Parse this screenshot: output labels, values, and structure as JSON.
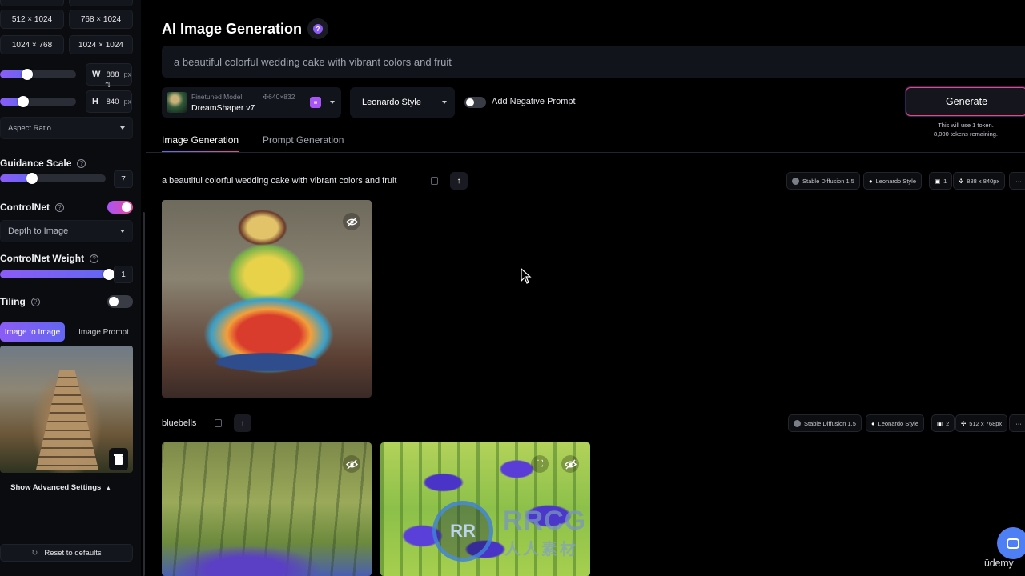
{
  "sidebar": {
    "dimensions": [
      {
        "label": "512 × 1024"
      },
      {
        "label": "768 × 1024"
      },
      {
        "label": "1024 × 768"
      },
      {
        "label": "1024 × 1024"
      }
    ],
    "width": {
      "label": "W",
      "value": "888",
      "unit": "px"
    },
    "height": {
      "label": "H",
      "value": "840",
      "unit": "px"
    },
    "swap_icon": "swap-vertical-arrows",
    "aspect_ratio": {
      "label": "Aspect Ratio"
    },
    "guidance_scale": {
      "label": "Guidance Scale",
      "value": "7",
      "fraction": 0.3
    },
    "controlnet": {
      "label": "ControlNet",
      "enabled": true,
      "mode": "Depth to Image"
    },
    "controlnet_weight": {
      "label": "ControlNet Weight",
      "value": "1",
      "fraction": 1.0
    },
    "tiling": {
      "label": "Tiling",
      "enabled": false
    },
    "image_tabs": [
      {
        "label": "Image to Image",
        "active": true
      },
      {
        "label": "Image Prompt",
        "active": false
      }
    ],
    "show_advanced": "Show Advanced Settings",
    "reset": "Reset to defaults"
  },
  "header": {
    "title": "AI Image Generation",
    "help_badge": "?",
    "prompt": "a beautiful colorful wedding cake with vibrant colors and fruit",
    "model": {
      "caption": "Finetuned Model",
      "resolution": "640×832",
      "name": "DreamShaper v7"
    },
    "style": "Leonardo Style",
    "negative_prompt_label": "Add Negative Prompt",
    "generate_label": "Generate",
    "token_line1": "This will use 1 token.",
    "token_line2": "8,000 tokens remaining."
  },
  "tabs": [
    {
      "label": "Image Generation",
      "active": true
    },
    {
      "label": "Prompt Generation",
      "active": false
    }
  ],
  "generations": [
    {
      "prompt": "a beautiful colorful wedding cake with vibrant colors and fruit",
      "model": "Stable Diffusion 1.5",
      "style": "Leonardo Style",
      "count": "1",
      "size": "888 x 840px",
      "more": "···"
    },
    {
      "prompt": "bluebells",
      "model": "Stable Diffusion 1.5",
      "style": "Leonardo Style",
      "count": "2",
      "size": "512 x 768px",
      "more": "···"
    }
  ],
  "watermark": {
    "brand": "RRCG",
    "sub": "人人素材",
    "mark": "RR"
  },
  "footer": {
    "udemy": "ūdemy"
  },
  "colors": {
    "accent_purple": "#8b5cf6",
    "accent_indigo": "#6366f1",
    "generate_border": "#e6487c",
    "background": "#000000",
    "panel": "#12141b"
  }
}
